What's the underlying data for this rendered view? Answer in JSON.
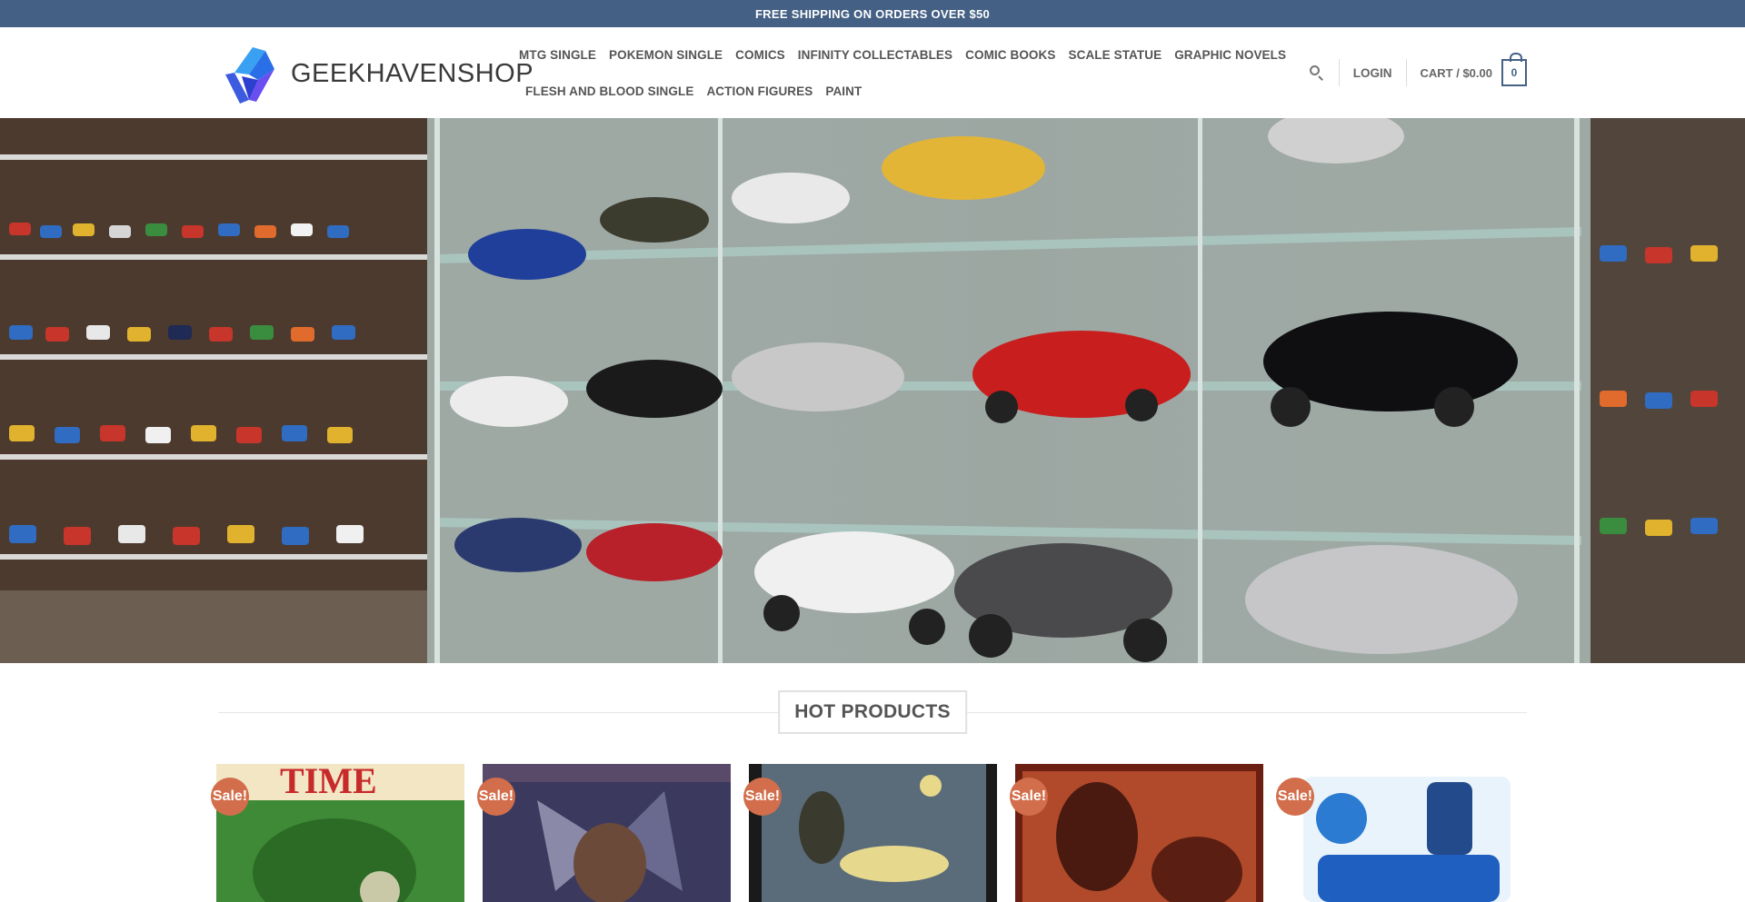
{
  "topbar": {
    "text": "FREE SHIPPING ON ORDERS OVER $50"
  },
  "header": {
    "logo_text": "GEEKHAVENSHOP",
    "nav_row1": [
      "MTG SINGLE",
      "POKEMON SINGLE",
      "COMICS",
      "INFINITY COLLECTABLES",
      "COMIC BOOKS",
      "SCALE STATUE",
      "GRAPHIC NOVELS"
    ],
    "nav_row2": [
      "FLESH AND BLOOD SINGLE",
      "ACTION FIGURES",
      "PAINT"
    ],
    "login": "LOGIN",
    "cart": "CART / $0.00",
    "cart_count": "0"
  },
  "hero": {
    "icon": "hero-banner-image"
  },
  "section": {
    "title": "HOT PRODUCTS"
  },
  "products": [
    {
      "badge": "Sale!"
    },
    {
      "badge": "Sale!"
    },
    {
      "badge": "Sale!"
    },
    {
      "badge": "Sale!"
    },
    {
      "badge": "Sale!"
    }
  ],
  "colors": {
    "primary": "#446084",
    "sale": "#d26e4b"
  }
}
